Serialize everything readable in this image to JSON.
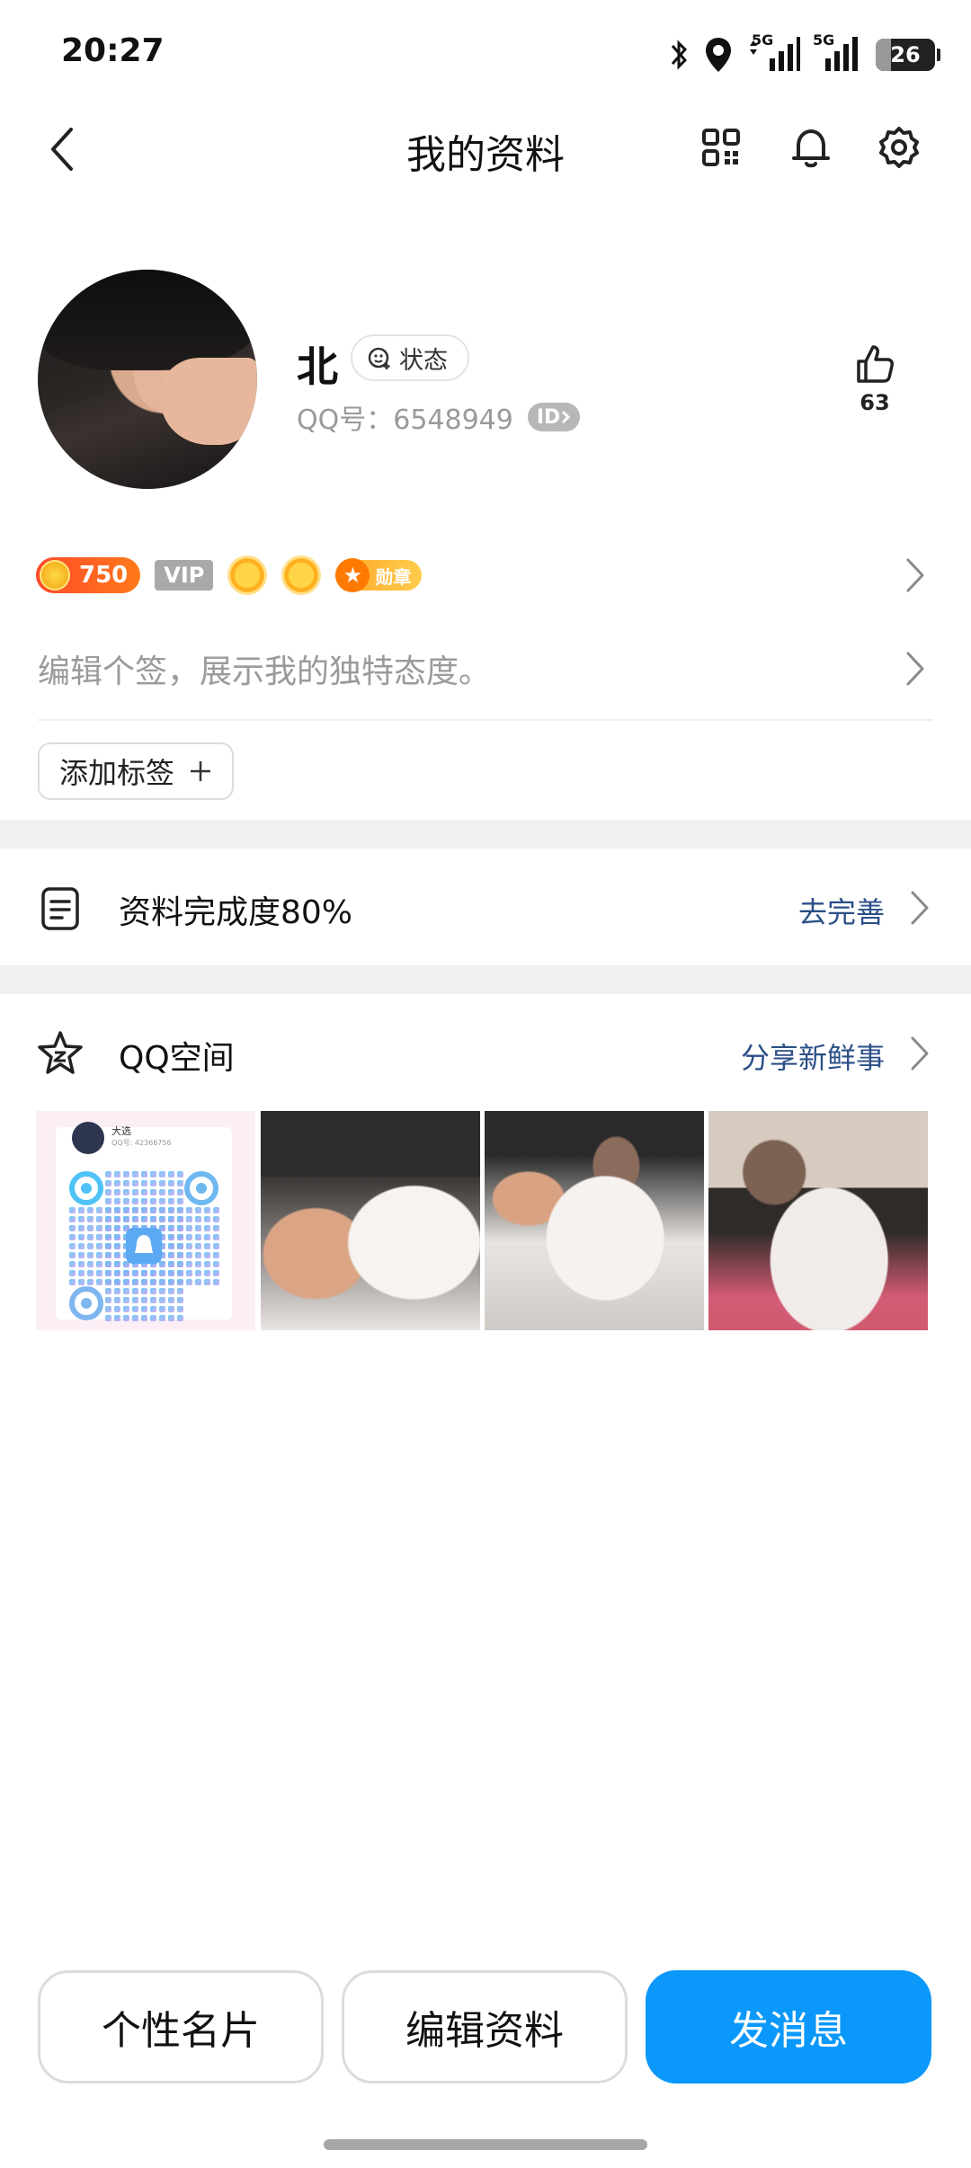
{
  "status_bar": {
    "time": "20:27",
    "battery": "26",
    "battery_level": 0.26,
    "signal_1": "5G",
    "signal_2": "5G"
  },
  "header": {
    "title": "我的资料"
  },
  "profile": {
    "nickname": "北",
    "state_label": "状态",
    "qq_number": "QQ号：6548949",
    "id_badge": "ID",
    "likes": "63"
  },
  "badges": {
    "level": "750",
    "vip": "VIP",
    "medal": "勋章"
  },
  "signature_placeholder": "编辑个签，展示我的独特态度。",
  "add_tag_label": "添加标签",
  "profile_completion": {
    "label": "资料完成度80%",
    "action": "去完善"
  },
  "qzone": {
    "title": "QQ空间",
    "action": "分享新鲜事",
    "qr_card_name": "大选",
    "qr_card_sub": "QQ号: 42366756"
  },
  "buttons": {
    "card": "个性名片",
    "edit": "编辑资料",
    "message": "发消息"
  },
  "colors": {
    "primary": "#0a98fb",
    "link": "#2b4f87",
    "band": "#f0f0f0"
  }
}
